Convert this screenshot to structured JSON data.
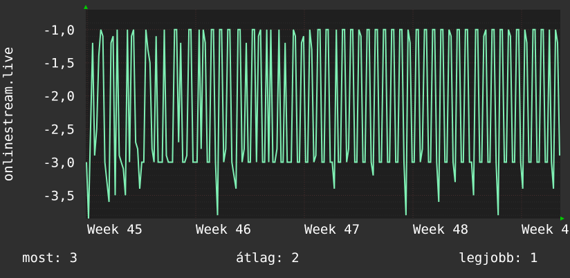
{
  "chart_data": {
    "type": "line",
    "ylabel": "onlinestream.live",
    "y_ticks": [
      "-1,0",
      "-1,5",
      "-2,0",
      "-2,5",
      "-3,0",
      "-3,5"
    ],
    "y_tick_values": [
      -1.0,
      -1.5,
      -2.0,
      -2.5,
      -3.0,
      -3.5
    ],
    "ylim": [
      -3.85,
      -0.7
    ],
    "x_ticks": [
      "Week 45",
      "Week 46",
      "Week 47",
      "Week 48",
      "Week 4"
    ],
    "grid": true,
    "colors": {
      "background": "#2f2f2f",
      "plot_background": "#1f1f1f",
      "line": "#7ff0b4",
      "grid_major": "#4a2e2e",
      "grid_minor": "#2c2c2c",
      "axis_arrow": "#00cc00"
    },
    "series": [
      {
        "values": [
          -3.0,
          -3.85,
          -2.5,
          -1.2,
          -2.9,
          -2.5,
          -1.4,
          -1.0,
          -1.1,
          -3.0,
          -3.3,
          -3.6,
          -1.2,
          -1.1,
          -3.5,
          -1.0,
          -2.9,
          -3.0,
          -3.1,
          -3.5,
          -1.0,
          -3.0,
          -1.1,
          -1.0,
          -2.7,
          -2.8,
          -3.4,
          -3.0,
          -3.0,
          -1.0,
          -1.3,
          -1.5,
          -2.8,
          -3.0,
          -1.1,
          -3.0,
          -3.0,
          -3.0,
          -1.0,
          -2.9,
          -3.0,
          -3.0,
          -3.0,
          -1.0,
          -1.0,
          -2.7,
          -1.2,
          -3.0,
          -3.0,
          -2.9,
          -1.0,
          -1.0,
          -3.0,
          -3.0,
          -3.0,
          -1.0,
          -2.8,
          -1.0,
          -1.2,
          -3.0,
          -3.0,
          -1.0,
          -1.0,
          -3.0,
          -3.8,
          -1.0,
          -1.0,
          -3.0,
          -2.8,
          -1.0,
          -1.0,
          -3.0,
          -3.2,
          -3.4,
          -1.0,
          -1.0,
          -3.0,
          -2.8,
          -1.2,
          -3.0,
          -3.0,
          -1.0,
          -1.0,
          -3.0,
          -1.1,
          -1.0,
          -3.0,
          -3.0,
          -1.0,
          -3.0,
          -1.0,
          -3.0,
          -3.0,
          -2.8,
          -1.0,
          -3.0,
          -3.0,
          -1.2,
          -3.0,
          -3.0,
          -3.0,
          -1.0,
          -1.1,
          -3.0,
          -3.0,
          -1.2,
          -1.1,
          -3.0,
          -3.0,
          -1.0,
          -1.3,
          -3.0,
          -2.9,
          -1.0,
          -1.0,
          -3.0,
          -3.0,
          -1.0,
          -1.0,
          -3.0,
          -3.0,
          -3.4,
          -1.0,
          -3.0,
          -3.0,
          -1.0,
          -1.0,
          -3.0,
          -2.8,
          -1.0,
          -1.0,
          -3.0,
          -3.0,
          -1.0,
          -1.1,
          -3.0,
          -3.0,
          -1.0,
          -1.0,
          -3.0,
          -3.2,
          -1.0,
          -1.0,
          -3.0,
          -3.0,
          -1.0,
          -1.0,
          -3.0,
          -3.0,
          -1.0,
          -1.0,
          -3.0,
          -3.0,
          -1.0,
          -1.0,
          -3.0,
          -3.8,
          -1.0,
          -1.2,
          -3.0,
          -3.0,
          -1.0,
          -1.0,
          -3.0,
          -2.8,
          -1.0,
          -1.0,
          -3.0,
          -3.0,
          -1.0,
          -1.0,
          -3.0,
          -3.6,
          -1.0,
          -1.0,
          -3.0,
          -3.0,
          -1.0,
          -1.1,
          -3.0,
          -3.3,
          -1.0,
          -1.0,
          -3.0,
          -3.0,
          -1.0,
          -1.0,
          -3.0,
          -3.0,
          -3.5,
          -1.0,
          -1.0,
          -3.0,
          -3.0,
          -1.1,
          -1.0,
          -3.0,
          -3.0,
          -1.0,
          -1.0,
          -3.0,
          -3.8,
          -1.0,
          -1.0,
          -3.0,
          -3.0,
          -1.0,
          -1.1,
          -3.0,
          -3.0,
          -1.0,
          -1.0,
          -3.0,
          -3.4,
          -1.0,
          -1.2,
          -3.0,
          -3.0,
          -1.0,
          -1.0,
          -3.0,
          -3.0,
          -1.0,
          -1.0,
          -3.0,
          -3.0,
          -1.0,
          -3.0,
          -3.4,
          -1.0,
          -1.2,
          -2.9
        ]
      }
    ]
  },
  "footer": {
    "now_label": "most: 3",
    "avg_label": "átlag: 2",
    "best_label": "legjobb: 1"
  }
}
